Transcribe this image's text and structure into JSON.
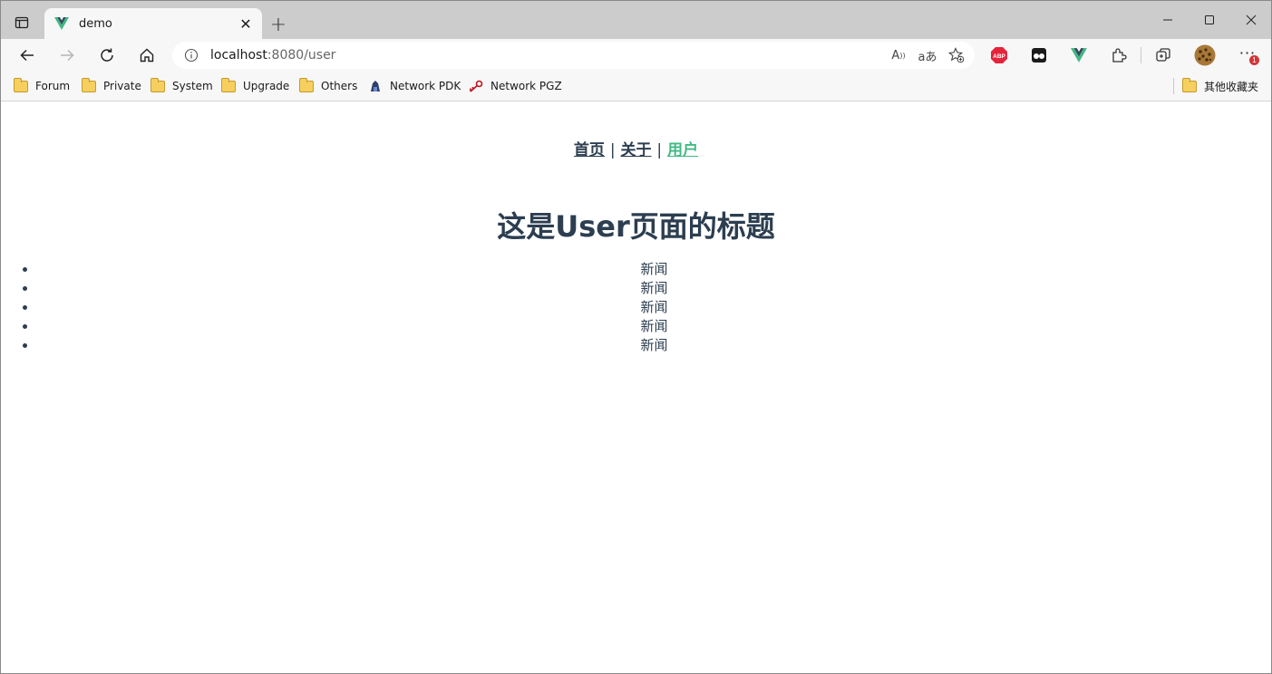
{
  "browser": {
    "tab_title": "demo",
    "address_host": "localhost",
    "address_path": ":8080/user",
    "bookmarks": [
      "Forum",
      "Private",
      "System",
      "Upgrade",
      "Others",
      "Network PDK",
      "Network PGZ"
    ],
    "other_bookmarks": "其他收藏夹",
    "extension_badge": "ABP",
    "notification_count": "1"
  },
  "page": {
    "nav": {
      "home": "首页",
      "about": "关于",
      "user": "用户",
      "separator": "|"
    },
    "heading": "这是User页面的标题",
    "news": [
      "新闻",
      "新闻",
      "新闻",
      "新闻",
      "新闻"
    ]
  },
  "colors": {
    "text": "#2c3e50",
    "active_link": "#42b983",
    "tabstrip": "#cccccc",
    "toolbar": "#f7f7f7"
  }
}
